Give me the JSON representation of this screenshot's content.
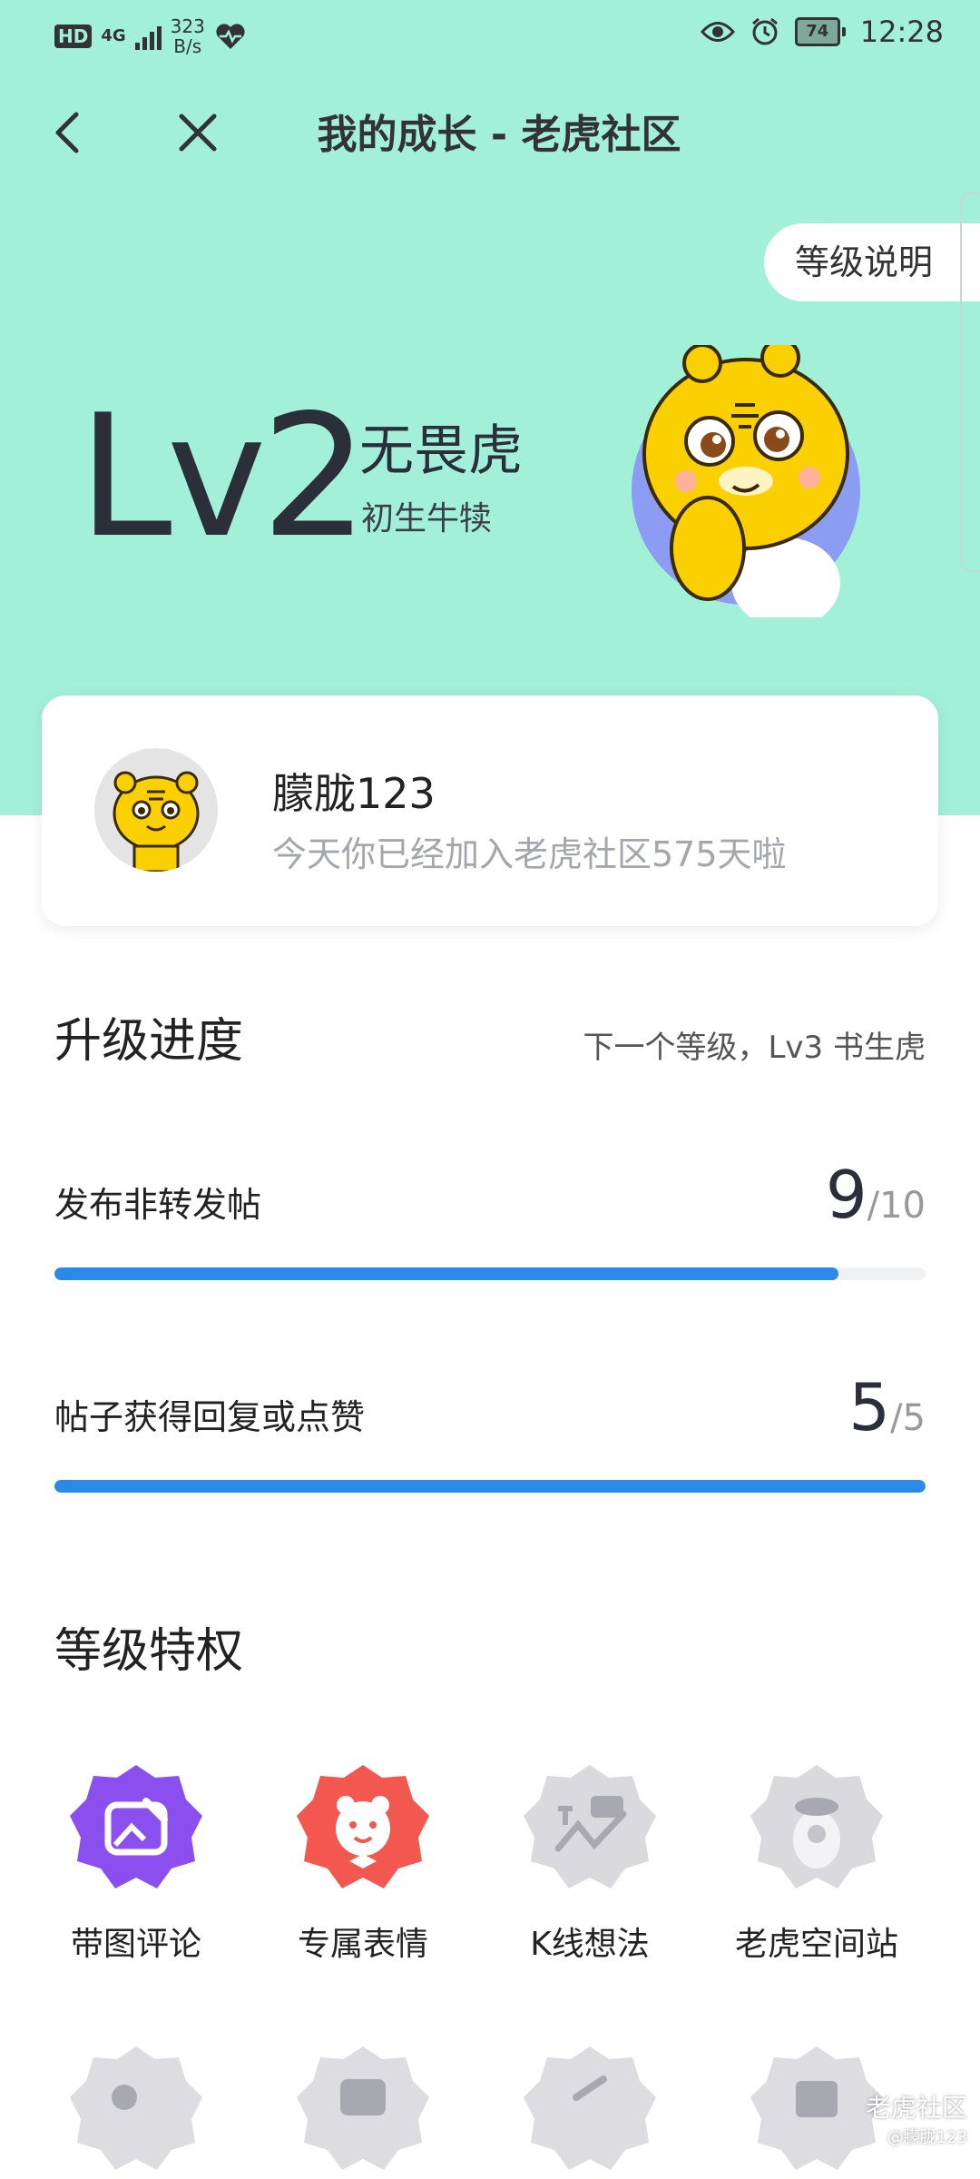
{
  "status_bar": {
    "hd": "HD",
    "network": "4G",
    "speed_value": "323",
    "speed_unit": "B/s",
    "battery": "74",
    "time": "12:28"
  },
  "nav": {
    "title": "我的成长 - 老虎社区"
  },
  "level_button": "等级说明",
  "level": {
    "code": "Lv2",
    "name": "无畏虎",
    "subtitle": "初生牛犊"
  },
  "user": {
    "name": "朦胧123",
    "desc": "今天你已经加入老虎社区575天啦"
  },
  "progress": {
    "title": "升级进度",
    "next_level": "下一个等级，Lv3 书生虎",
    "tasks": [
      {
        "label": "发布非转发帖",
        "current": "9",
        "total": "/10",
        "fraction": 0.9
      },
      {
        "label": "帖子获得回复或点赞",
        "current": "5",
        "total": "/5",
        "fraction": 1.0
      }
    ]
  },
  "privileges": {
    "title": "等级特权",
    "items": [
      {
        "label": "带图评论",
        "icon": "image-comment-icon",
        "color": "#8b4ff0",
        "active": true
      },
      {
        "label": "专属表情",
        "icon": "exclusive-emoji-icon",
        "color": "#f2584f",
        "active": true
      },
      {
        "label": "K线想法",
        "icon": "kline-idea-icon",
        "color": "#d9d9de",
        "active": false
      },
      {
        "label": "老虎空间站",
        "icon": "space-station-icon",
        "color": "#d9d9de",
        "active": false
      }
    ]
  },
  "watermark": {
    "line1": "老虎社区",
    "line2": "@朦胧123"
  }
}
